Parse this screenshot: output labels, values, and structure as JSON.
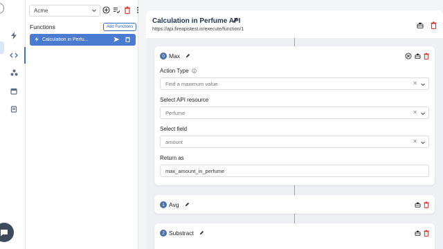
{
  "sidebar": {
    "items": [
      {
        "icon": "bolt-icon"
      },
      {
        "icon": "code-icon"
      },
      {
        "icon": "nodes-icon"
      },
      {
        "icon": "calendar-icon"
      },
      {
        "icon": "book-icon"
      }
    ]
  },
  "functions_panel": {
    "project_selector": "Acme",
    "title": "Functions",
    "add_button": "Add Functions",
    "items": [
      {
        "label": "Calculation in Perfu..."
      }
    ]
  },
  "main": {
    "title": "Calculation in Perfume API",
    "url": "https://api.fireapistest.in/execute/function/1",
    "steps": [
      {
        "index": "0",
        "name": "Max",
        "fields": [
          {
            "label": "Action Type",
            "value": "Find a maximum value"
          },
          {
            "label": "Select API resource",
            "value": "Perfume"
          },
          {
            "label": "Select field",
            "value": "amount"
          },
          {
            "label": "Return as",
            "value": "max_amount_in_perfume"
          }
        ]
      },
      {
        "index": "1",
        "name": "Avg"
      },
      {
        "index": "2",
        "name": "Substract"
      }
    ]
  },
  "colors": {
    "accent": "#3b6fc4",
    "selected_item": "#4a7bd0",
    "delete": "#d9342b"
  }
}
